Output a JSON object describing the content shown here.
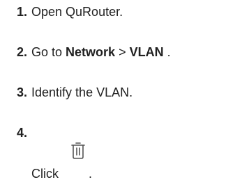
{
  "steps": [
    {
      "number": "1.",
      "text": "Open QuRouter."
    },
    {
      "number": "2.",
      "prefix": "Go to ",
      "menu1": "Network",
      "separator": " > ",
      "menu2": "VLAN",
      "suffix": " ."
    },
    {
      "number": "3.",
      "text": "Identify the VLAN."
    },
    {
      "number": "4.",
      "prefix": "Click ",
      "icon": "trash-icon",
      "suffix": "."
    }
  ]
}
